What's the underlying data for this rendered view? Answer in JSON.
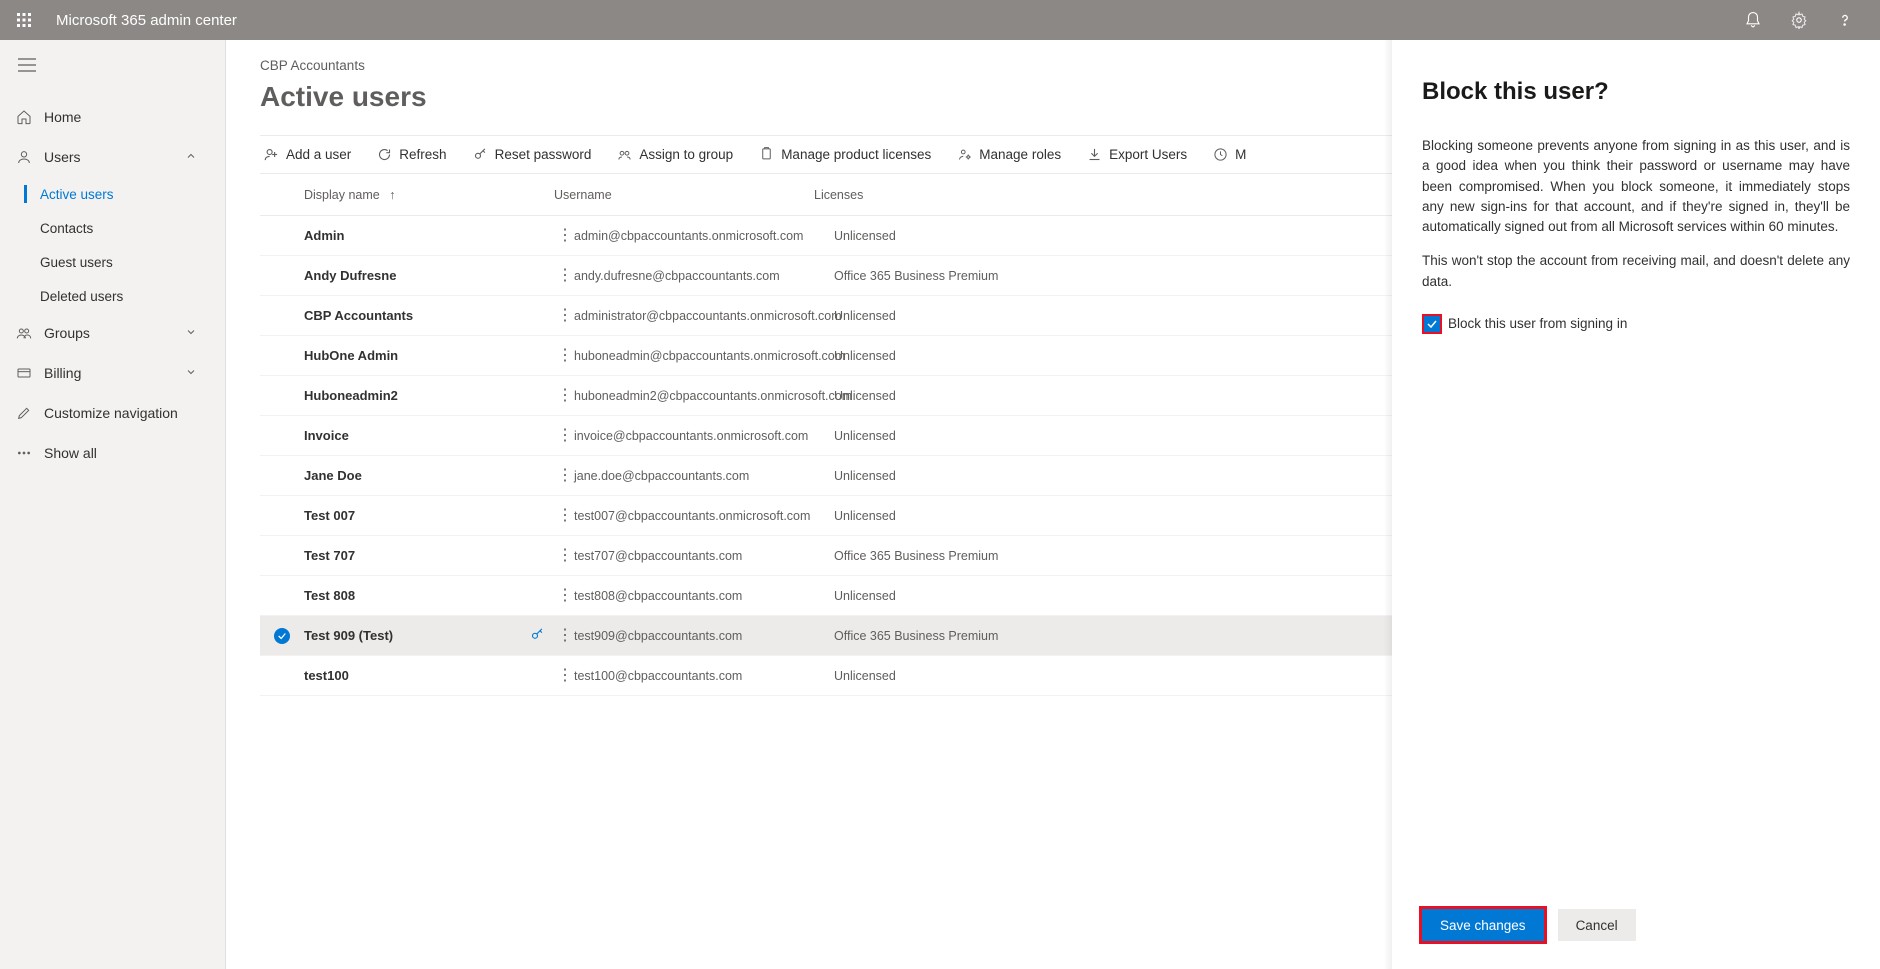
{
  "topbar": {
    "title": "Microsoft 365 admin center"
  },
  "sidebar": {
    "items": [
      {
        "label": "Home"
      },
      {
        "label": "Users",
        "expanded": true,
        "children": [
          {
            "label": "Active users",
            "active": true
          },
          {
            "label": "Contacts"
          },
          {
            "label": "Guest users"
          },
          {
            "label": "Deleted users"
          }
        ]
      },
      {
        "label": "Groups",
        "expandable": true
      },
      {
        "label": "Billing",
        "expandable": true
      },
      {
        "label": "Customize navigation"
      },
      {
        "label": "Show all"
      }
    ]
  },
  "page": {
    "breadcrumb": "CBP Accountants",
    "title": "Active users"
  },
  "commands": {
    "add_user": "Add a user",
    "refresh": "Refresh",
    "reset_password": "Reset password",
    "assign_to_group": "Assign to group",
    "manage_licenses": "Manage product licenses",
    "manage_roles": "Manage roles",
    "export_users": "Export Users",
    "more": "M"
  },
  "table": {
    "columns": {
      "display_name": "Display name",
      "username": "Username",
      "licenses": "Licenses"
    },
    "rows": [
      {
        "name": "Admin",
        "user": "admin@cbpaccountants.onmicrosoft.com",
        "lic": "Unlicensed",
        "selected": false
      },
      {
        "name": "Andy Dufresne",
        "user": "andy.dufresne@cbpaccountants.com",
        "lic": "Office 365 Business Premium",
        "selected": false
      },
      {
        "name": "CBP Accountants",
        "user": "administrator@cbpaccountants.onmicrosoft.com",
        "lic": "Unlicensed",
        "selected": false
      },
      {
        "name": "HubOne Admin",
        "user": "huboneadmin@cbpaccountants.onmicrosoft.com",
        "lic": "Unlicensed",
        "selected": false
      },
      {
        "name": "Huboneadmin2",
        "user": "huboneadmin2@cbpaccountants.onmicrosoft.com",
        "lic": "Unlicensed",
        "selected": false
      },
      {
        "name": "Invoice",
        "user": "invoice@cbpaccountants.onmicrosoft.com",
        "lic": "Unlicensed",
        "selected": false
      },
      {
        "name": "Jane Doe",
        "user": "jane.doe@cbpaccountants.com",
        "lic": "Unlicensed",
        "selected": false
      },
      {
        "name": "Test 007",
        "user": "test007@cbpaccountants.onmicrosoft.com",
        "lic": "Unlicensed",
        "selected": false
      },
      {
        "name": "Test 707",
        "user": "test707@cbpaccountants.com",
        "lic": "Office 365 Business Premium",
        "selected": false
      },
      {
        "name": "Test 808",
        "user": "test808@cbpaccountants.com",
        "lic": "Unlicensed",
        "selected": false
      },
      {
        "name": "Test 909 (Test)",
        "user": "test909@cbpaccountants.com",
        "lic": "Office 365 Business Premium",
        "selected": true
      },
      {
        "name": "test100",
        "user": "test100@cbpaccountants.com",
        "lic": "Unlicensed",
        "selected": false
      }
    ]
  },
  "panel": {
    "title": "Block this user?",
    "p1": "Blocking someone prevents anyone from signing in as this user, and is a good idea when you think their password or username may have been compromised. When you block someone, it immediately stops any new sign-ins for that account, and if they're signed in, they'll be automatically signed out from all Microsoft services within 60 minutes.",
    "p2": "This won't stop the account from receiving mail, and doesn't delete any data.",
    "checkbox_label": "Block this user from signing in",
    "save": "Save changes",
    "cancel": "Cancel"
  }
}
